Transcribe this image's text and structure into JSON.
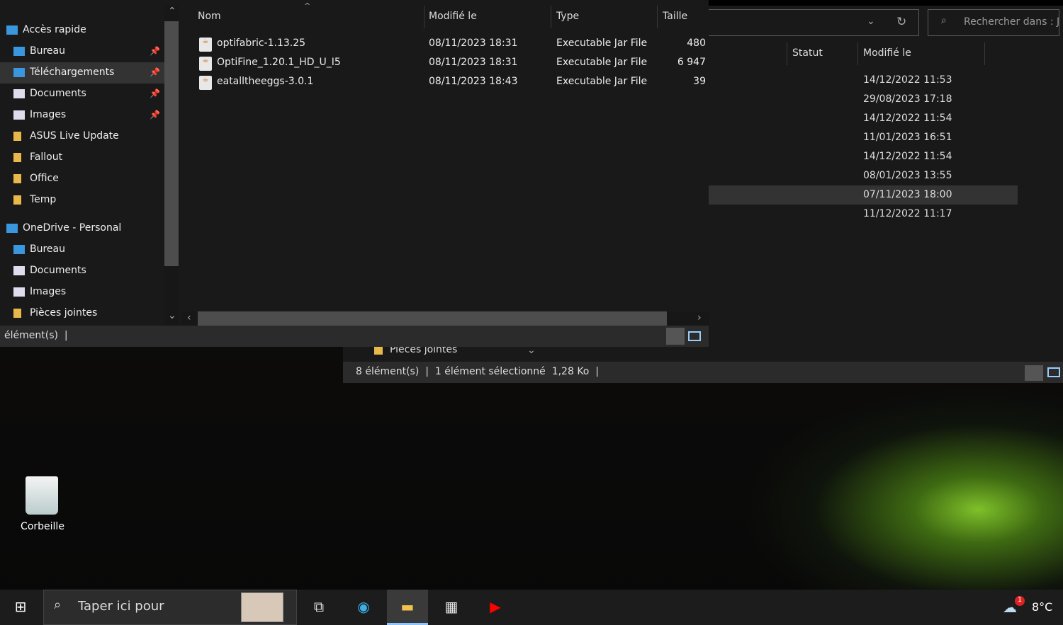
{
  "back_window": {
    "search_placeholder": "Rechercher dans : J...",
    "columns": [
      "Statut",
      "Modifié le"
    ],
    "dates": [
      "14/12/2022 11:53",
      "29/08/2023 17:18",
      "14/12/2022 11:54",
      "11/01/2023 16:51",
      "14/12/2022 11:54",
      "08/01/2023 13:55",
      "07/11/2023 18:00",
      "11/12/2022 11:17"
    ],
    "nav_item": "Pièces jointes",
    "status": {
      "count": "8 élément(s)",
      "selected": "1 élément sélectionné",
      "size": "1,28 Ko"
    }
  },
  "dialog": {
    "nav": [
      {
        "label": "Accès rapide",
        "icon": "star-icon"
      },
      {
        "label": "Bureau",
        "icon": "desktop-icon",
        "pinned": true
      },
      {
        "label": "Téléchargements",
        "icon": "download-icon",
        "pinned": true,
        "selected": true
      },
      {
        "label": "Documents",
        "icon": "document-icon",
        "pinned": true
      },
      {
        "label": "Images",
        "icon": "image-icon",
        "pinned": true
      },
      {
        "label": "ASUS Live Update",
        "icon": "folder-icon"
      },
      {
        "label": "Fallout",
        "icon": "folder-icon"
      },
      {
        "label": "Office",
        "icon": "folder-icon"
      },
      {
        "label": "Temp",
        "icon": "folder-icon"
      },
      {
        "label": "OneDrive - Personal",
        "icon": "cloud-icon"
      },
      {
        "label": "Bureau",
        "icon": "desktop-icon"
      },
      {
        "label": "Documents",
        "icon": "document-icon"
      },
      {
        "label": "Images",
        "icon": "image-icon"
      },
      {
        "label": "Pièces jointes",
        "icon": "folder-icon"
      }
    ],
    "columns": {
      "name": "Nom",
      "modified": "Modifié le",
      "type": "Type",
      "size": "Taille"
    },
    "files": [
      {
        "name": "optifabric-1.13.25",
        "modified": "08/11/2023 18:31",
        "type": "Executable Jar File",
        "size": "480"
      },
      {
        "name": "OptiFine_1.20.1_HD_U_I5",
        "modified": "08/11/2023 18:31",
        "type": "Executable Jar File",
        "size": "6 947"
      },
      {
        "name": "eatalltheeggs-3.0.1",
        "modified": "08/11/2023 18:43",
        "type": "Executable Jar File",
        "size": "39"
      }
    ],
    "status": "élément(s)"
  },
  "desktop": {
    "recycle_bin": "Corbeille"
  },
  "taskbar": {
    "search_placeholder": "Taper ici pour",
    "temperature": "8°C",
    "weather_badge": "1"
  }
}
